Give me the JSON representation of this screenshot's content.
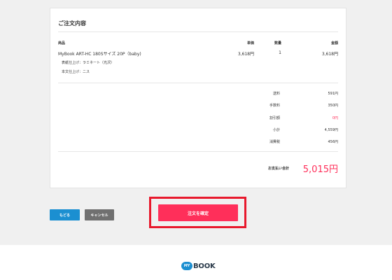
{
  "order": {
    "title": "ご注文内容",
    "headers": {
      "item": "商品",
      "unit_price": "単価",
      "quantity": "数量",
      "amount": "金額"
    },
    "item": {
      "name": "MyBook ART-HC 180Sサイズ 20P（baby)",
      "unit_price": "3,618円",
      "quantity": "1",
      "amount": "3,618円",
      "options": [
        "表紙仕上げ：ラミネート（光沢）",
        "本文仕上げ：ニス"
      ]
    },
    "summary": [
      {
        "label": "送料",
        "value": "591円"
      },
      {
        "label": "手数料",
        "value": "350円"
      },
      {
        "label": "割引額",
        "value": "0円"
      },
      {
        "label": "小計",
        "value": "4,559円"
      },
      {
        "label": "消費税",
        "value": "456円"
      }
    ],
    "total": {
      "label": "お支払い合計",
      "value": "5,015円"
    }
  },
  "buttons": {
    "back": "もどる",
    "cancel": "キャンセル",
    "confirm": "注文を確定"
  },
  "footer": {
    "logo_my": "MY",
    "logo_book": "BOOK"
  },
  "colors": {
    "accent": "#ff2f5a",
    "back_button": "#1b8fd1",
    "cancel_button": "#707070",
    "highlight": "#e8192d"
  }
}
